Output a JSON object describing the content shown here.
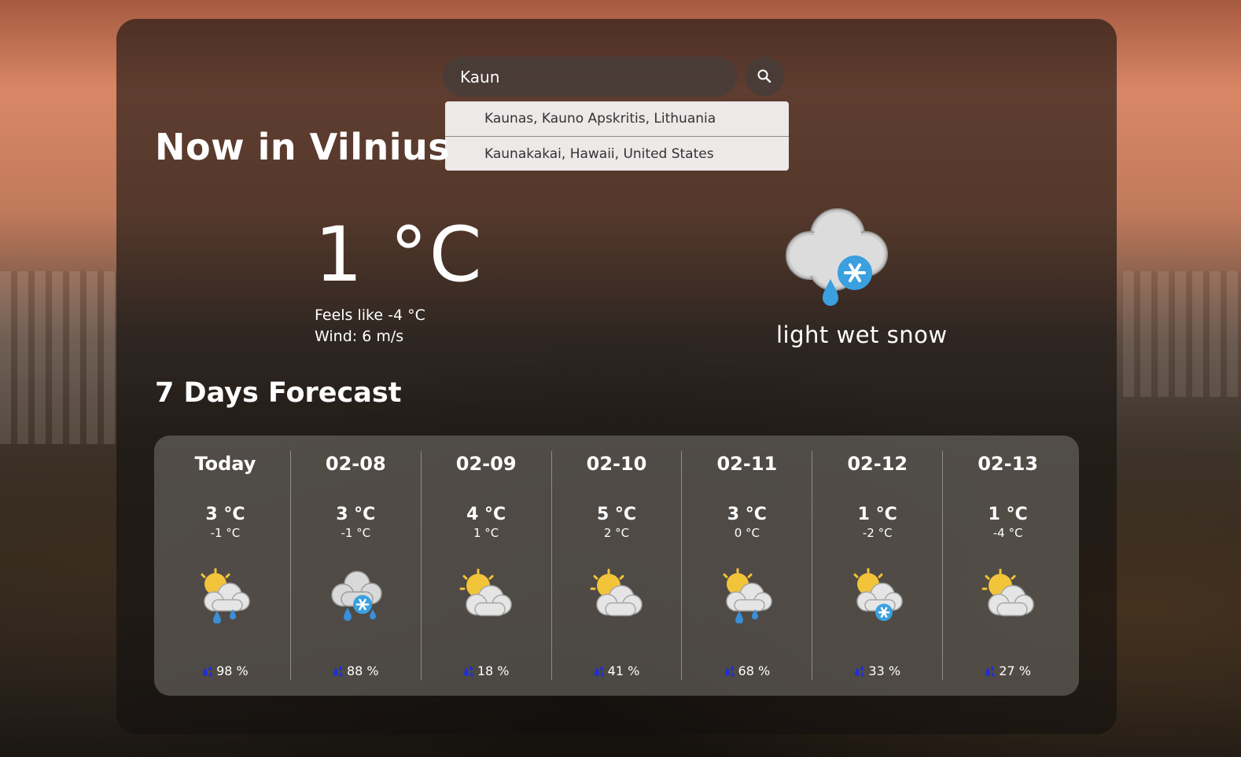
{
  "search": {
    "value": "Kaun"
  },
  "suggestions": [
    "Kaunas, Kauno Apskritis, Lithuania",
    "Kaunakakai, Hawaii, United States"
  ],
  "current": {
    "title": "Now in Vilnius",
    "temp": "1 °C",
    "feels_like": "Feels like -4 °C",
    "wind": "Wind: 6 m/s",
    "condition": "light wet snow",
    "icon": "cloud-snow-rain-icon"
  },
  "forecast": {
    "title": "7 Days Forecast",
    "days": [
      {
        "label": "Today",
        "max": "3 °C",
        "min": "-1 °C",
        "icon": "partly-cloudy-rain-icon",
        "precip": "98 %"
      },
      {
        "label": "02-08",
        "max": "3 °C",
        "min": "-1 °C",
        "icon": "cloud-snow-rain-icon",
        "precip": "88 %"
      },
      {
        "label": "02-09",
        "max": "4 °C",
        "min": "1 °C",
        "icon": "partly-cloudy-icon",
        "precip": "18 %"
      },
      {
        "label": "02-10",
        "max": "5 °C",
        "min": "2 °C",
        "icon": "partly-cloudy-icon",
        "precip": "41 %"
      },
      {
        "label": "02-11",
        "max": "3 °C",
        "min": "0 °C",
        "icon": "partly-cloudy-rain-icon",
        "precip": "68 %"
      },
      {
        "label": "02-12",
        "max": "1 °C",
        "min": "-2 °C",
        "icon": "partly-cloudy-snow-icon",
        "precip": "33 %"
      },
      {
        "label": "02-13",
        "max": "1 °C",
        "min": "-4 °C",
        "icon": "partly-cloudy-icon",
        "precip": "27 %"
      }
    ]
  },
  "colors": {
    "precip_drop": "#1f2fd6",
    "sun": "#f2c43a",
    "cloud": "#e8e8e8",
    "rain": "#3a8fd8"
  }
}
